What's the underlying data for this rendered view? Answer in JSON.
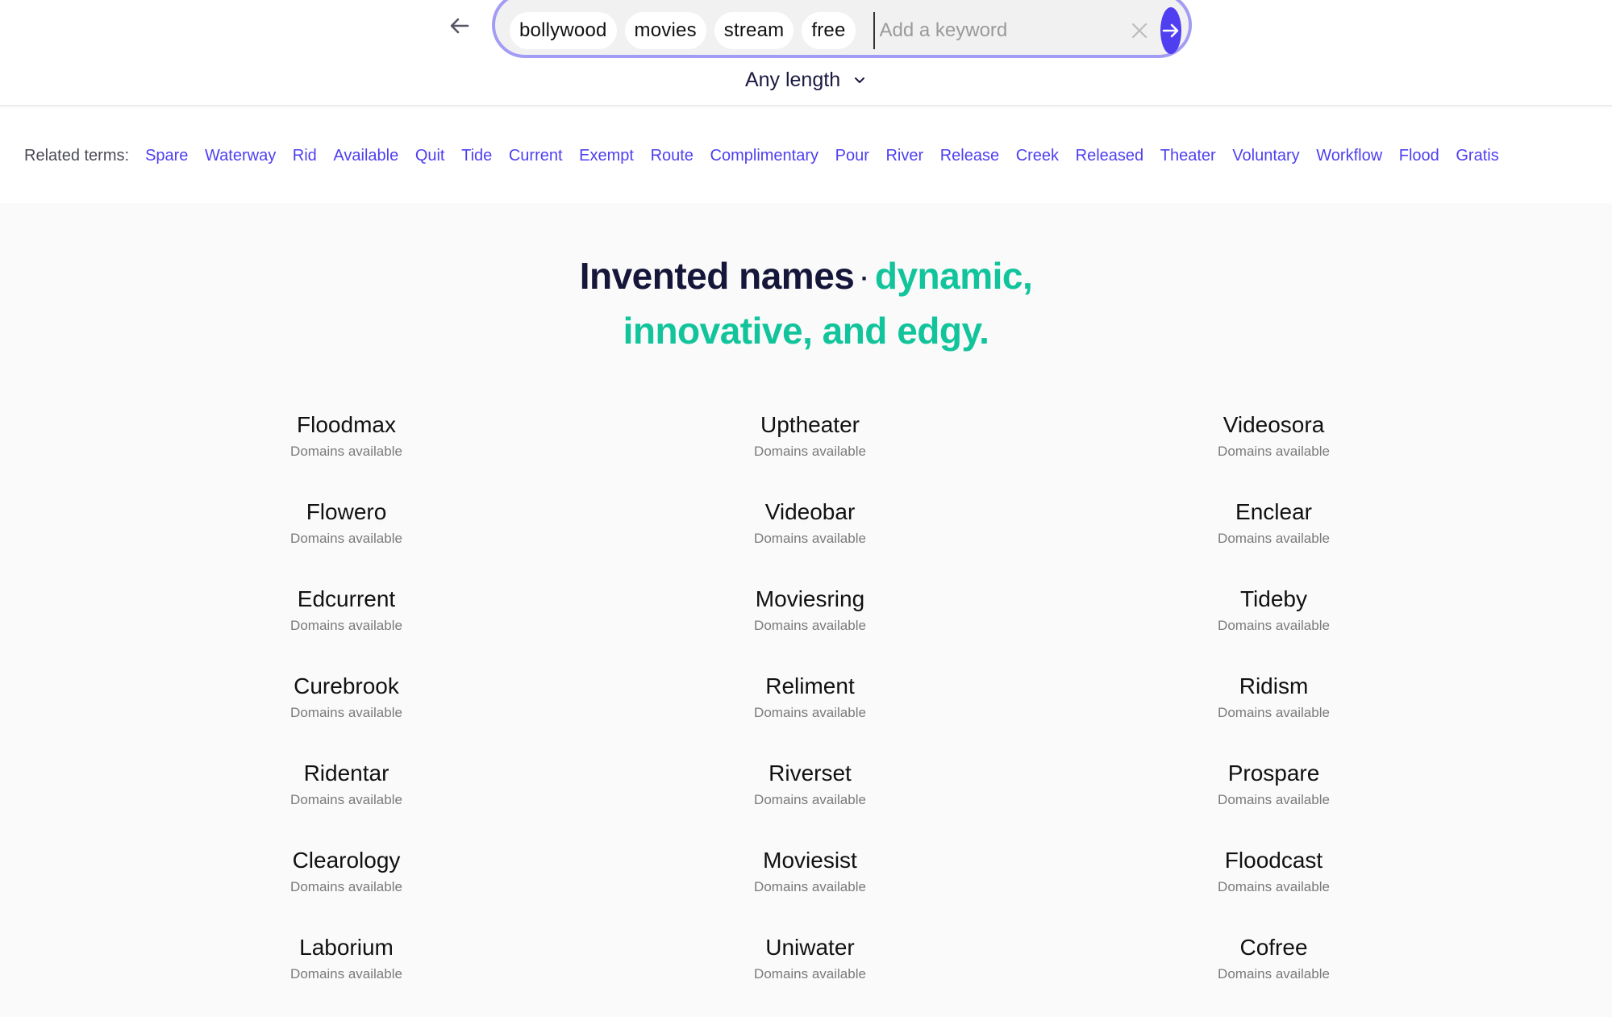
{
  "search": {
    "chips": [
      "bollywood",
      "movies",
      "stream",
      "free"
    ],
    "input_value": "",
    "input_placeholder": "Add a keyword",
    "back_icon": "arrow-left-icon",
    "clear_icon": "close-icon",
    "submit_icon": "arrow-right-icon"
  },
  "filter": {
    "length_label": "Any length",
    "length_icon": "chevron-down-icon"
  },
  "related": {
    "label": "Related terms:",
    "terms": [
      "Spare",
      "Waterway",
      "Rid",
      "Available",
      "Quit",
      "Tide",
      "Current",
      "Exempt",
      "Route",
      "Complimentary",
      "Pour",
      "River",
      "Release",
      "Creek",
      "Released",
      "Theater",
      "Voluntary",
      "Workflow",
      "Flood",
      "Gratis"
    ]
  },
  "hero": {
    "title_dark": "Invented names",
    "separator": "·",
    "title_green_line1": "dynamic,",
    "title_green_line2": "innovative, and edgy."
  },
  "colors": {
    "accent": "#4f3ff0",
    "search_border": "#a39cf5",
    "highlight_green": "#12c49b",
    "heading_dark": "#16163a"
  },
  "results": [
    [
      {
        "name": "Floodmax",
        "status": "Domains available"
      },
      {
        "name": "Uptheater",
        "status": "Domains available"
      },
      {
        "name": "Videosora",
        "status": "Domains available"
      }
    ],
    [
      {
        "name": "Flowero",
        "status": "Domains available"
      },
      {
        "name": "Videobar",
        "status": "Domains available"
      },
      {
        "name": "Enclear",
        "status": "Domains available"
      }
    ],
    [
      {
        "name": "Edcurrent",
        "status": "Domains available"
      },
      {
        "name": "Moviesring",
        "status": "Domains available"
      },
      {
        "name": "Tideby",
        "status": "Domains available"
      }
    ],
    [
      {
        "name": "Curebrook",
        "status": "Domains available"
      },
      {
        "name": "Reliment",
        "status": "Domains available"
      },
      {
        "name": "Ridism",
        "status": "Domains available"
      }
    ],
    [
      {
        "name": "Ridentar",
        "status": "Domains available"
      },
      {
        "name": "Riverset",
        "status": "Domains available"
      },
      {
        "name": "Prospare",
        "status": "Domains available"
      }
    ],
    [
      {
        "name": "Clearology",
        "status": "Domains available"
      },
      {
        "name": "Moviesist",
        "status": "Domains available"
      },
      {
        "name": "Floodcast",
        "status": "Domains available"
      }
    ],
    [
      {
        "name": "Laborium",
        "status": "Domains available"
      },
      {
        "name": "Uniwater",
        "status": "Domains available"
      },
      {
        "name": "Cofree",
        "status": "Domains available"
      }
    ]
  ]
}
